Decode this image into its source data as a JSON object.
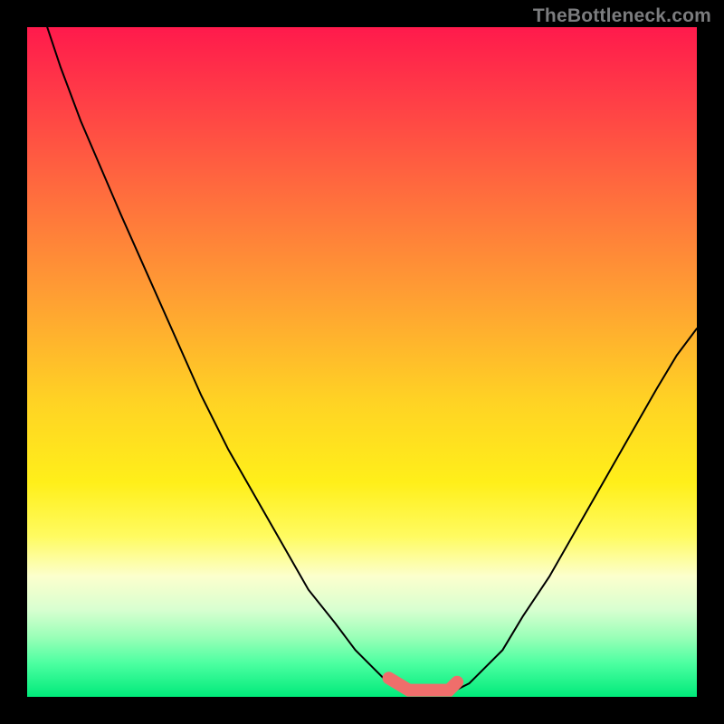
{
  "watermark": "TheBottleneck.com",
  "chart_data": {
    "type": "line",
    "title": "",
    "xlabel": "",
    "ylabel": "",
    "xlim": [
      0,
      100
    ],
    "ylim": [
      0,
      100
    ],
    "grid": false,
    "legend": false,
    "notes": "Background is a vertical rainbow gradient (red at top → green at bottom). Two thin black curves meet near the bottom center forming a V shape; a short pink/coral segment sits at the valley. No axis tick labels or numeric annotations are visible, so x/y are on an arbitrary 0–100 scale estimated from pixel position.",
    "series": [
      {
        "name": "left-curve",
        "color": "#000000",
        "stroke_width": 2,
        "x": [
          3,
          5,
          8,
          11,
          14,
          18,
          22,
          26,
          30,
          34,
          38,
          42,
          46,
          49,
          52,
          54,
          55.5,
          56.5
        ],
        "y": [
          100,
          94,
          86,
          79,
          72,
          63,
          54,
          45,
          37,
          30,
          23,
          16,
          11,
          7,
          4,
          2,
          1.2,
          1
        ]
      },
      {
        "name": "right-curve",
        "color": "#000000",
        "stroke_width": 2,
        "x": [
          64,
          66,
          68,
          71,
          74,
          78,
          82,
          86,
          90,
          94,
          97,
          100
        ],
        "y": [
          1,
          2,
          4,
          7,
          12,
          18,
          25,
          32,
          39,
          46,
          51,
          55
        ]
      },
      {
        "name": "valley-highlight",
        "color": "#ef6e6b",
        "stroke_width": 10,
        "x": [
          54,
          57,
          60,
          63,
          64.2
        ],
        "y": [
          2.8,
          1,
          1,
          1,
          2.2
        ]
      }
    ]
  }
}
